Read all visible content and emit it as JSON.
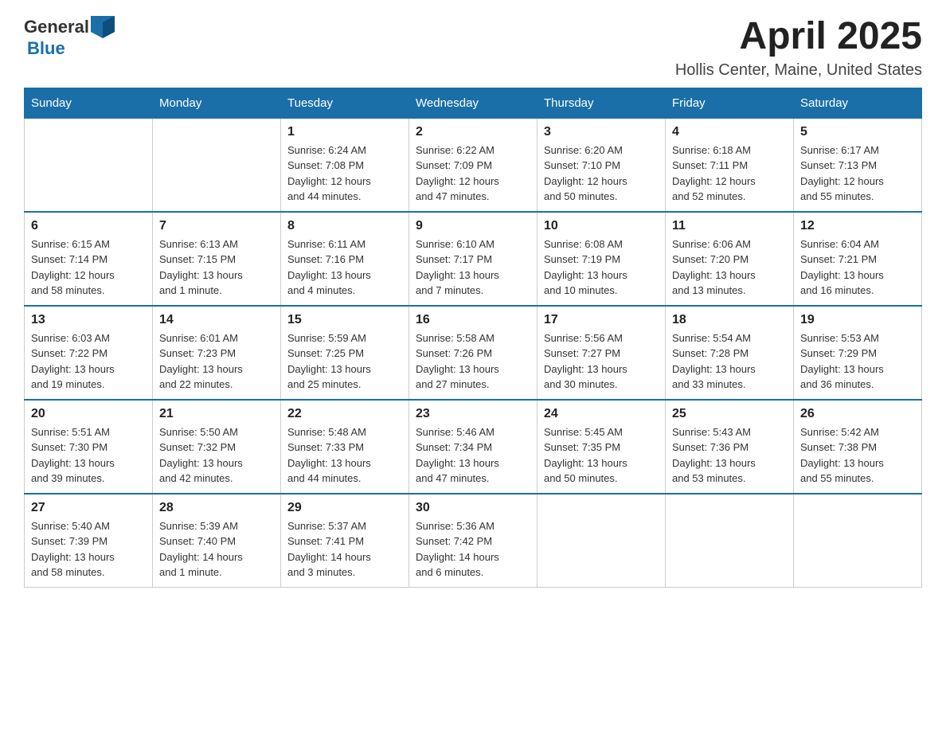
{
  "header": {
    "logo": {
      "general": "General",
      "blue": "Blue"
    },
    "title": "April 2025",
    "location": "Hollis Center, Maine, United States"
  },
  "days_of_week": [
    "Sunday",
    "Monday",
    "Tuesday",
    "Wednesday",
    "Thursday",
    "Friday",
    "Saturday"
  ],
  "weeks": [
    {
      "days": [
        {
          "number": "",
          "info": ""
        },
        {
          "number": "",
          "info": ""
        },
        {
          "number": "1",
          "info": "Sunrise: 6:24 AM\nSunset: 7:08 PM\nDaylight: 12 hours\nand 44 minutes."
        },
        {
          "number": "2",
          "info": "Sunrise: 6:22 AM\nSunset: 7:09 PM\nDaylight: 12 hours\nand 47 minutes."
        },
        {
          "number": "3",
          "info": "Sunrise: 6:20 AM\nSunset: 7:10 PM\nDaylight: 12 hours\nand 50 minutes."
        },
        {
          "number": "4",
          "info": "Sunrise: 6:18 AM\nSunset: 7:11 PM\nDaylight: 12 hours\nand 52 minutes."
        },
        {
          "number": "5",
          "info": "Sunrise: 6:17 AM\nSunset: 7:13 PM\nDaylight: 12 hours\nand 55 minutes."
        }
      ]
    },
    {
      "days": [
        {
          "number": "6",
          "info": "Sunrise: 6:15 AM\nSunset: 7:14 PM\nDaylight: 12 hours\nand 58 minutes."
        },
        {
          "number": "7",
          "info": "Sunrise: 6:13 AM\nSunset: 7:15 PM\nDaylight: 13 hours\nand 1 minute."
        },
        {
          "number": "8",
          "info": "Sunrise: 6:11 AM\nSunset: 7:16 PM\nDaylight: 13 hours\nand 4 minutes."
        },
        {
          "number": "9",
          "info": "Sunrise: 6:10 AM\nSunset: 7:17 PM\nDaylight: 13 hours\nand 7 minutes."
        },
        {
          "number": "10",
          "info": "Sunrise: 6:08 AM\nSunset: 7:19 PM\nDaylight: 13 hours\nand 10 minutes."
        },
        {
          "number": "11",
          "info": "Sunrise: 6:06 AM\nSunset: 7:20 PM\nDaylight: 13 hours\nand 13 minutes."
        },
        {
          "number": "12",
          "info": "Sunrise: 6:04 AM\nSunset: 7:21 PM\nDaylight: 13 hours\nand 16 minutes."
        }
      ]
    },
    {
      "days": [
        {
          "number": "13",
          "info": "Sunrise: 6:03 AM\nSunset: 7:22 PM\nDaylight: 13 hours\nand 19 minutes."
        },
        {
          "number": "14",
          "info": "Sunrise: 6:01 AM\nSunset: 7:23 PM\nDaylight: 13 hours\nand 22 minutes."
        },
        {
          "number": "15",
          "info": "Sunrise: 5:59 AM\nSunset: 7:25 PM\nDaylight: 13 hours\nand 25 minutes."
        },
        {
          "number": "16",
          "info": "Sunrise: 5:58 AM\nSunset: 7:26 PM\nDaylight: 13 hours\nand 27 minutes."
        },
        {
          "number": "17",
          "info": "Sunrise: 5:56 AM\nSunset: 7:27 PM\nDaylight: 13 hours\nand 30 minutes."
        },
        {
          "number": "18",
          "info": "Sunrise: 5:54 AM\nSunset: 7:28 PM\nDaylight: 13 hours\nand 33 minutes."
        },
        {
          "number": "19",
          "info": "Sunrise: 5:53 AM\nSunset: 7:29 PM\nDaylight: 13 hours\nand 36 minutes."
        }
      ]
    },
    {
      "days": [
        {
          "number": "20",
          "info": "Sunrise: 5:51 AM\nSunset: 7:30 PM\nDaylight: 13 hours\nand 39 minutes."
        },
        {
          "number": "21",
          "info": "Sunrise: 5:50 AM\nSunset: 7:32 PM\nDaylight: 13 hours\nand 42 minutes."
        },
        {
          "number": "22",
          "info": "Sunrise: 5:48 AM\nSunset: 7:33 PM\nDaylight: 13 hours\nand 44 minutes."
        },
        {
          "number": "23",
          "info": "Sunrise: 5:46 AM\nSunset: 7:34 PM\nDaylight: 13 hours\nand 47 minutes."
        },
        {
          "number": "24",
          "info": "Sunrise: 5:45 AM\nSunset: 7:35 PM\nDaylight: 13 hours\nand 50 minutes."
        },
        {
          "number": "25",
          "info": "Sunrise: 5:43 AM\nSunset: 7:36 PM\nDaylight: 13 hours\nand 53 minutes."
        },
        {
          "number": "26",
          "info": "Sunrise: 5:42 AM\nSunset: 7:38 PM\nDaylight: 13 hours\nand 55 minutes."
        }
      ]
    },
    {
      "days": [
        {
          "number": "27",
          "info": "Sunrise: 5:40 AM\nSunset: 7:39 PM\nDaylight: 13 hours\nand 58 minutes."
        },
        {
          "number": "28",
          "info": "Sunrise: 5:39 AM\nSunset: 7:40 PM\nDaylight: 14 hours\nand 1 minute."
        },
        {
          "number": "29",
          "info": "Sunrise: 5:37 AM\nSunset: 7:41 PM\nDaylight: 14 hours\nand 3 minutes."
        },
        {
          "number": "30",
          "info": "Sunrise: 5:36 AM\nSunset: 7:42 PM\nDaylight: 14 hours\nand 6 minutes."
        },
        {
          "number": "",
          "info": ""
        },
        {
          "number": "",
          "info": ""
        },
        {
          "number": "",
          "info": ""
        }
      ]
    }
  ]
}
